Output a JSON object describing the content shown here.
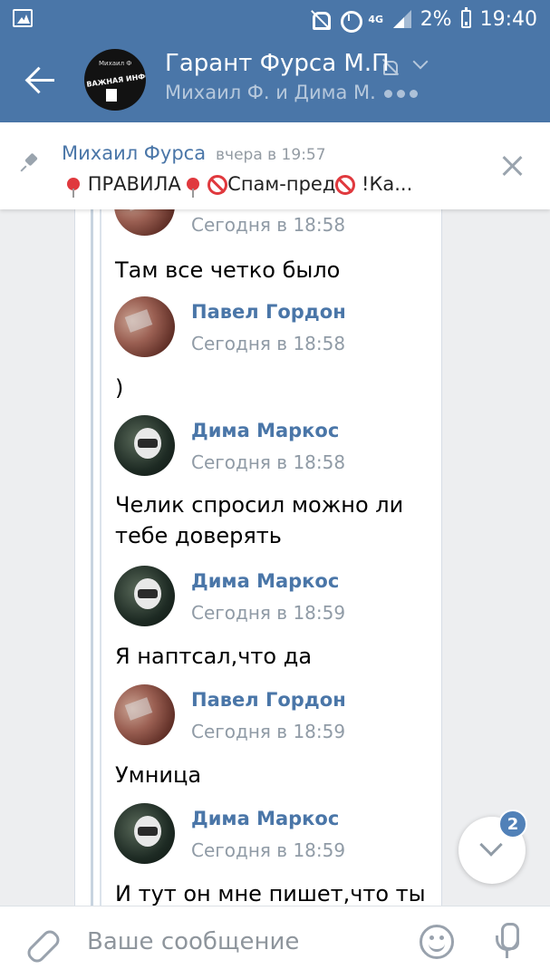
{
  "status_bar": {
    "network": "4G",
    "battery": "2%",
    "time": "19:40"
  },
  "header": {
    "title": "Гарант Фурса М.П",
    "members": "Михаил Ф. и Дима М.",
    "avatar_small_text": "Михаил Ф",
    "avatar_text": "ВАЖНАЯ ИНФОРМАЦ"
  },
  "pinned": {
    "author": "Михаил Фурса",
    "time": "вчера в 19:57",
    "text_1": "ПРАВИЛА",
    "text_2": "Спам-пред",
    "text_3": "!Ка..."
  },
  "messages": [
    {
      "author": "",
      "time": "Сегодня в 18:58",
      "text": "Там все четко было",
      "avatar": "pavel"
    },
    {
      "author": "Павел Гордон",
      "time": "Сегодня в 18:58",
      "text": ")",
      "avatar": "pavel"
    },
    {
      "author": "Дима Маркос",
      "time": "Сегодня в 18:58",
      "text": "Челик спросил можно ли тебе доверять",
      "avatar": "dima"
    },
    {
      "author": "Дима Маркос",
      "time": "Сегодня в 18:59",
      "text": "Я наптсал,что да",
      "avatar": "dima"
    },
    {
      "author": "Павел Гордон",
      "time": "Сегодня в 18:59",
      "text": "Умница",
      "avatar": "pavel"
    },
    {
      "author": "Дима Маркос",
      "time": "Сегодня в 18:59",
      "text": "И тут он мне пишет,что ты",
      "avatar": "dima"
    }
  ],
  "scroll_button": {
    "unread_count": "2"
  },
  "composer": {
    "placeholder": "Ваше сообщение"
  },
  "colors": {
    "accent": "#4a76a8",
    "link": "#4a76a8",
    "badge": "#5181b8"
  }
}
